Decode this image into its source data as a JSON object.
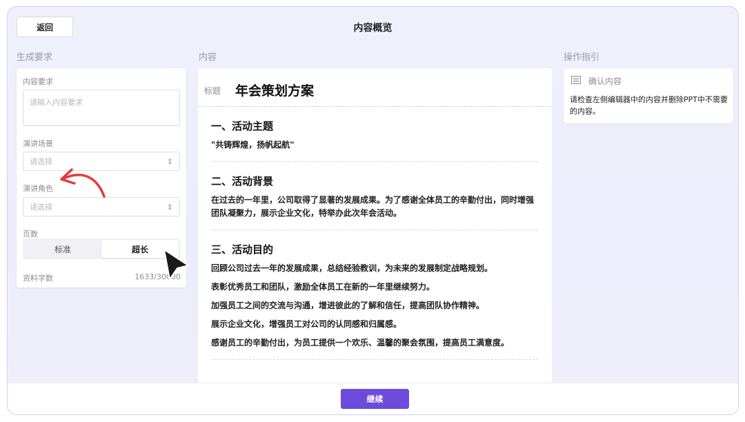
{
  "header": {
    "back_label": "返回",
    "title": "内容概览"
  },
  "sections": {
    "requirements": "生成要求",
    "content": "内容",
    "guide": "操作指引"
  },
  "form": {
    "content_req_label": "内容要求",
    "content_req_placeholder": "请输入内容要求",
    "scene_label": "演讲场景",
    "scene_placeholder": "请选择",
    "role_label": "演讲角色",
    "role_placeholder": "请选择",
    "pages_label": "页数",
    "pages_options": [
      "标准",
      "超长"
    ],
    "pages_selected": "超长",
    "wordcount_label": "资料字数",
    "wordcount_value": "1633/30000"
  },
  "content": {
    "title_tag": "标题",
    "title": "年会策划方案",
    "sections": [
      {
        "heading": "一、活动主题",
        "paragraphs": [
          "\"共铸辉煌，扬帆起航\""
        ]
      },
      {
        "heading": "二、活动背景",
        "paragraphs": [
          "在过去的一年里，公司取得了显著的发展成果。为了感谢全体员工的辛勤付出，同时增强团队凝聚力，展示企业文化，特举办此次年会活动。"
        ]
      },
      {
        "heading": "三、活动目的",
        "paragraphs": [
          "回顾公司过去一年的发展成果，总结经验教训，为未来的发展制定战略规划。",
          "表彰优秀员工和团队，激励全体员工在新的一年里继续努力。",
          "加强员工之间的交流与沟通，增进彼此的了解和信任，提高团队协作精神。",
          "展示企业文化，增强员工对公司的认同感和归属感。",
          "感谢员工的辛勤付出，为员工提供一个欢乐、温馨的聚会氛围，提高员工满意度。"
        ]
      }
    ]
  },
  "guide": {
    "title": "确认内容",
    "text": "请检查左侧编辑器中的内容并删除PPT中不需要的内容。"
  },
  "footer": {
    "continue_label": "继续"
  },
  "icons": {
    "select_chevron": "chevron-updown-icon",
    "guide_icon": "document-lines-icon"
  },
  "colors": {
    "accent": "#6c4bdc",
    "annotation_arrow": "#e23b3b"
  }
}
